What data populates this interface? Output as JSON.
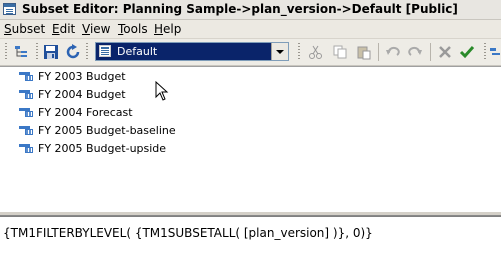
{
  "window": {
    "title": "Subset Editor:  Planning Sample->plan_version->Default  [Public]"
  },
  "menu": {
    "items": [
      {
        "label": "Subset",
        "underline": "S"
      },
      {
        "label": "Edit",
        "underline": "E"
      },
      {
        "label": "View",
        "underline": "V"
      },
      {
        "label": "Tools",
        "underline": "T"
      },
      {
        "label": "Help",
        "underline": "H"
      }
    ]
  },
  "toolbar": {
    "subset_select": {
      "value": "Default"
    },
    "icons": [
      "tree-icon",
      "save-icon",
      "refresh-icon",
      "cut-icon",
      "copy-icon",
      "paste-icon",
      "undo-icon",
      "redo-icon",
      "delete-icon",
      "check-icon"
    ]
  },
  "elements": [
    "FY 2003 Budget",
    "FY 2004 Budget",
    "FY 2004 Forecast",
    "FY 2005 Budget-baseline",
    "FY 2005 Budget-upside"
  ],
  "expression": "{TM1FILTERBYLEVEL( {TM1SUBSETALL( [plan_version] )}, 0)}"
}
